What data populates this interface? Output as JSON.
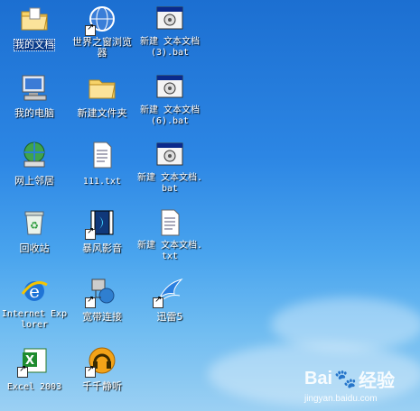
{
  "desktop": {
    "icons": [
      {
        "label": "我的文档"
      },
      {
        "label": "世界之窗浏览器"
      },
      {
        "label": "新建 文本文档 (3).bat"
      },
      {
        "label": "我的电脑"
      },
      {
        "label": "新建文件夹"
      },
      {
        "label": "新建 文本文档 (6).bat"
      },
      {
        "label": "网上邻居"
      },
      {
        "label": "111.txt"
      },
      {
        "label": "新建 文本文档.bat"
      },
      {
        "label": "回收站"
      },
      {
        "label": "暴风影音"
      },
      {
        "label": "新建 文本文档.txt"
      },
      {
        "label": "Internet Explorer"
      },
      {
        "label": "宽带连接"
      },
      {
        "label": "迅雷5"
      },
      {
        "label": "Excel 2003"
      },
      {
        "label": "千千静听"
      }
    ]
  },
  "watermark": {
    "brand": "Bai",
    "brand_cn": "经验",
    "url": "jingyan.baidu.com"
  },
  "colors": {
    "accent": "#2c86e4"
  }
}
